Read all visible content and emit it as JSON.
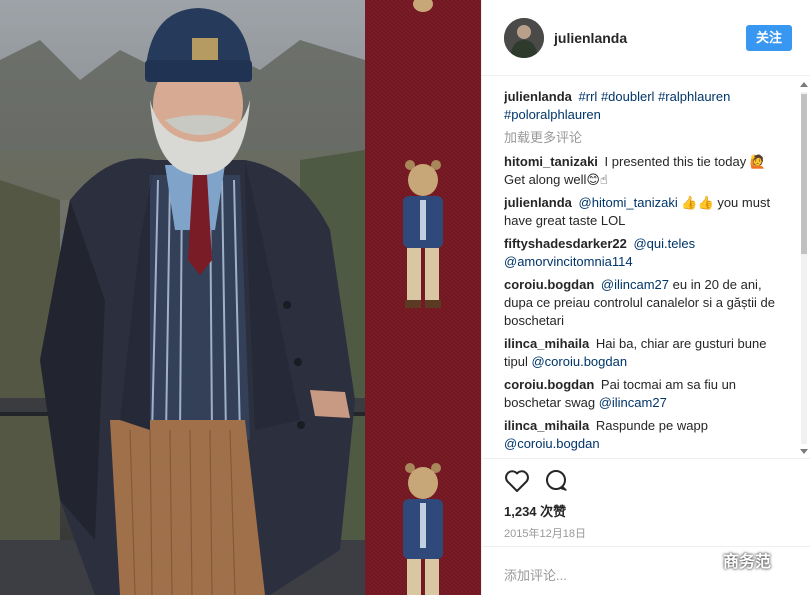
{
  "post": {
    "username": "julienlanda",
    "follow_label": "关注",
    "load_more_label": "加载更多评论",
    "likes_label": "1,234 次赞",
    "date_label": "2015年12月18日",
    "add_comment_placeholder": "添加评论..."
  },
  "caption": {
    "author": "julienlanda",
    "tags": [
      "#rrl",
      "#doublerl",
      "#ralphlauren",
      "#poloralphlauren"
    ]
  },
  "comments": [
    {
      "author": "hitomi_tanizaki",
      "text": "I presented this tie today 🙋 Get along well😊☝"
    },
    {
      "author": "julienlanda",
      "mention": "@hitomi_tanizaki",
      "text": "👍👍 you must have great taste LOL"
    },
    {
      "author": "fiftyshadesdarker22",
      "mention": "@qui.teles",
      "mention2": "@amorvincitomnia114"
    },
    {
      "author": "coroiu.bogdan",
      "mention": "@ilincam27",
      "text": "eu in 20 de ani, dupa ce preiau controlul canalelor si a găștii de boschetari"
    },
    {
      "author": "ilinca_mihaila",
      "text": "Hai ba, chiar are gusturi bune tipul",
      "mention": "@coroiu.bogdan"
    },
    {
      "author": "coroiu.bogdan",
      "text": "Pai tocmai am sa fiu un boschetar swag",
      "mention": "@ilincam27"
    },
    {
      "author": "ilinca_mihaila",
      "text": "Raspunde pe wapp",
      "mention": "@coroiu.bogdan"
    }
  ],
  "watermark": {
    "label": "商务范"
  },
  "colors": {
    "accent": "#3897f0",
    "tag": "#003569",
    "muted": "#999999",
    "tie_red": "#7a1c25"
  },
  "icons": {
    "like": "heart-icon",
    "comment": "comment-bubble-icon",
    "watermark": "wechat-icon"
  }
}
